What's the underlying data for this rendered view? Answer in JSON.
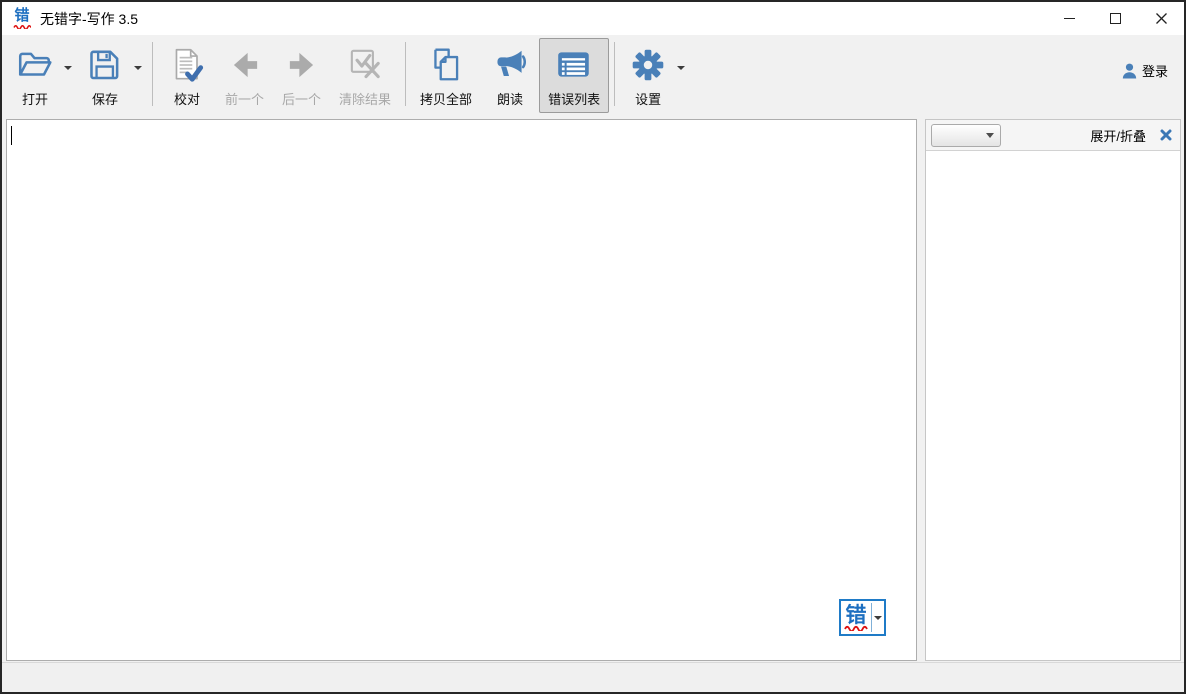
{
  "window": {
    "title": "无错字-写作 3.5",
    "app_icon_char": "错"
  },
  "toolbar": {
    "buttons": [
      {
        "label": "打开",
        "icon": "open-folder-icon",
        "dropdown": true,
        "enabled": true,
        "selected": false
      },
      {
        "label": "保存",
        "icon": "save-icon",
        "dropdown": true,
        "enabled": true,
        "selected": false
      },
      {
        "label": "校对",
        "icon": "proofread-icon",
        "dropdown": false,
        "enabled": true,
        "selected": false
      },
      {
        "label": "前一个",
        "icon": "previous-arrow-icon",
        "dropdown": false,
        "enabled": false,
        "selected": false
      },
      {
        "label": "后一个",
        "icon": "next-arrow-icon",
        "dropdown": false,
        "enabled": false,
        "selected": false
      },
      {
        "label": "清除结果",
        "icon": "clear-results-icon",
        "dropdown": false,
        "enabled": false,
        "selected": false
      },
      {
        "label": "拷贝全部",
        "icon": "copy-all-icon",
        "dropdown": false,
        "enabled": true,
        "selected": false
      },
      {
        "label": "朗读",
        "icon": "read-aloud-icon",
        "dropdown": false,
        "enabled": true,
        "selected": false
      },
      {
        "label": "错误列表",
        "icon": "error-list-icon",
        "dropdown": false,
        "enabled": true,
        "selected": true
      },
      {
        "label": "设置",
        "icon": "settings-gear-icon",
        "dropdown": true,
        "enabled": true,
        "selected": false
      }
    ],
    "login_label": "登录"
  },
  "editor": {
    "content": "",
    "floating_button_label": "错"
  },
  "right_panel": {
    "combo_value": "",
    "expand_collapse_label": "展开/折叠"
  },
  "status_bar": {
    "text": ""
  },
  "colors": {
    "accent_blue": "#4a80b8",
    "app_char_blue": "#1d6fc0",
    "disabled_gray": "#b0b0b0",
    "error_red": "#dd1111",
    "selected_button_bg": "#dcdcdc",
    "floating_button_border": "#1f7bc7",
    "panel_close_blue": "#3a77b5"
  }
}
